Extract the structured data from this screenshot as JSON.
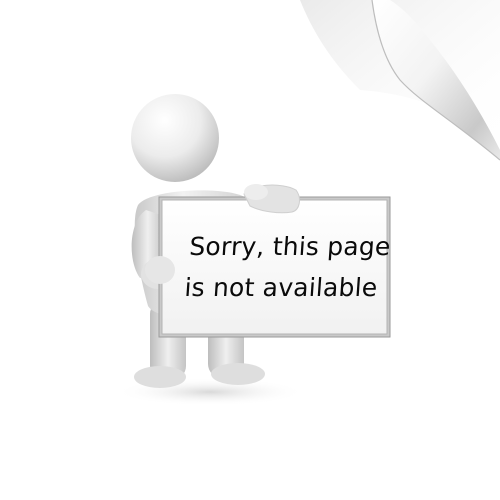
{
  "message": {
    "line1": "Sorry, this page",
    "line2": "is not available"
  },
  "colors": {
    "background": "#ffffff",
    "figure": "#e6e6e6",
    "board": "#fafafa",
    "board_frame": "#c8c8c8",
    "text": "#0a0a0a"
  },
  "icons": [
    "page-curl-icon",
    "person-figure-icon"
  ]
}
